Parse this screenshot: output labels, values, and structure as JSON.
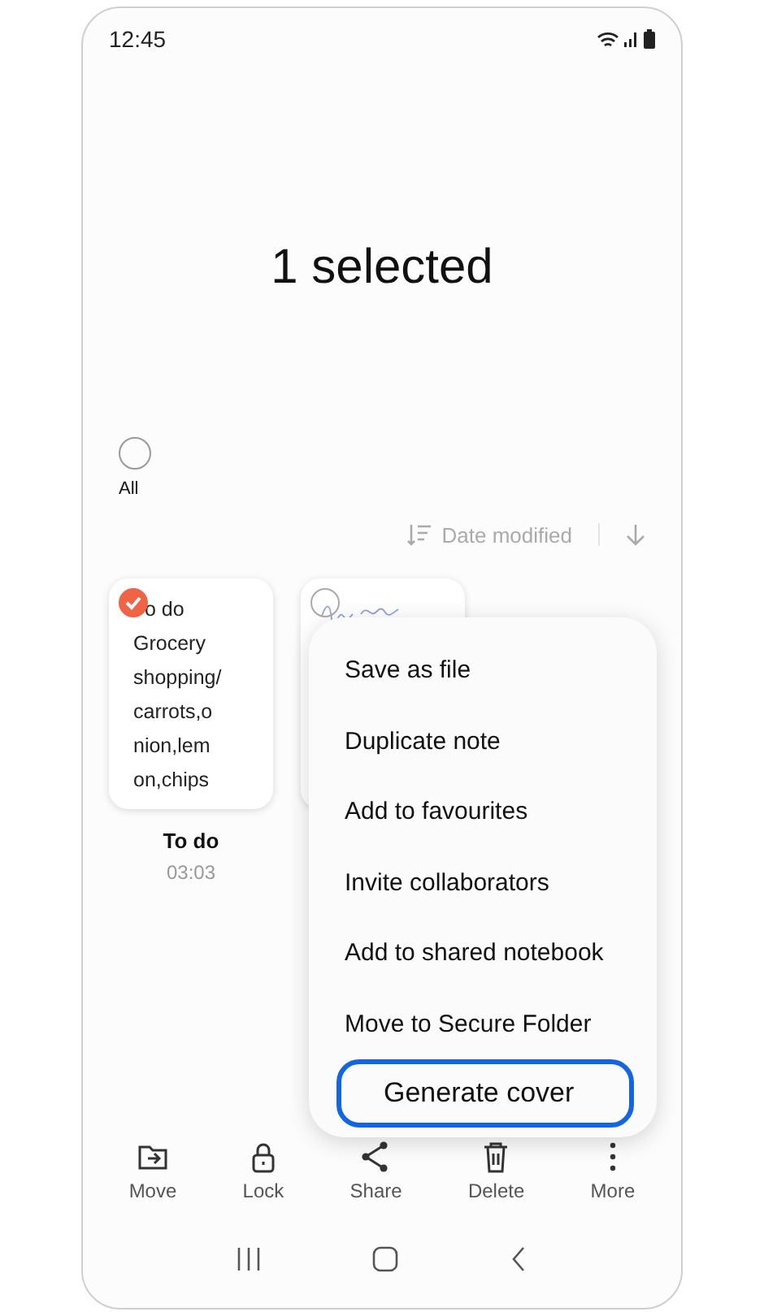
{
  "status_bar": {
    "time": "12:45"
  },
  "title": "1 selected",
  "select_all": {
    "label": "All",
    "checked": false
  },
  "sort": {
    "label": "Date modified"
  },
  "notes": [
    {
      "kind": "text",
      "selected": true,
      "preview": [
        "o do",
        "Grocery",
        "shopping/",
        "carrots,o",
        "nion,lem",
        "on,chips"
      ],
      "title": "To do",
      "time": "03:03"
    },
    {
      "kind": "handwriting",
      "selected": false
    }
  ],
  "menu": [
    {
      "label": "Save as file",
      "highlighted": false
    },
    {
      "label": "Duplicate note",
      "highlighted": false
    },
    {
      "label": "Add to favourites",
      "highlighted": false
    },
    {
      "label": "Invite collaborators",
      "highlighted": false
    },
    {
      "label": "Add to shared notebook",
      "highlighted": false
    },
    {
      "label": "Move to Secure Folder",
      "highlighted": false
    },
    {
      "label": "Generate cover",
      "highlighted": true
    }
  ],
  "toolbar": [
    {
      "kind": "move",
      "label": "Move"
    },
    {
      "kind": "lock",
      "label": "Lock"
    },
    {
      "kind": "share",
      "label": "Share"
    },
    {
      "kind": "delete",
      "label": "Delete"
    },
    {
      "kind": "more",
      "label": "More"
    }
  ]
}
